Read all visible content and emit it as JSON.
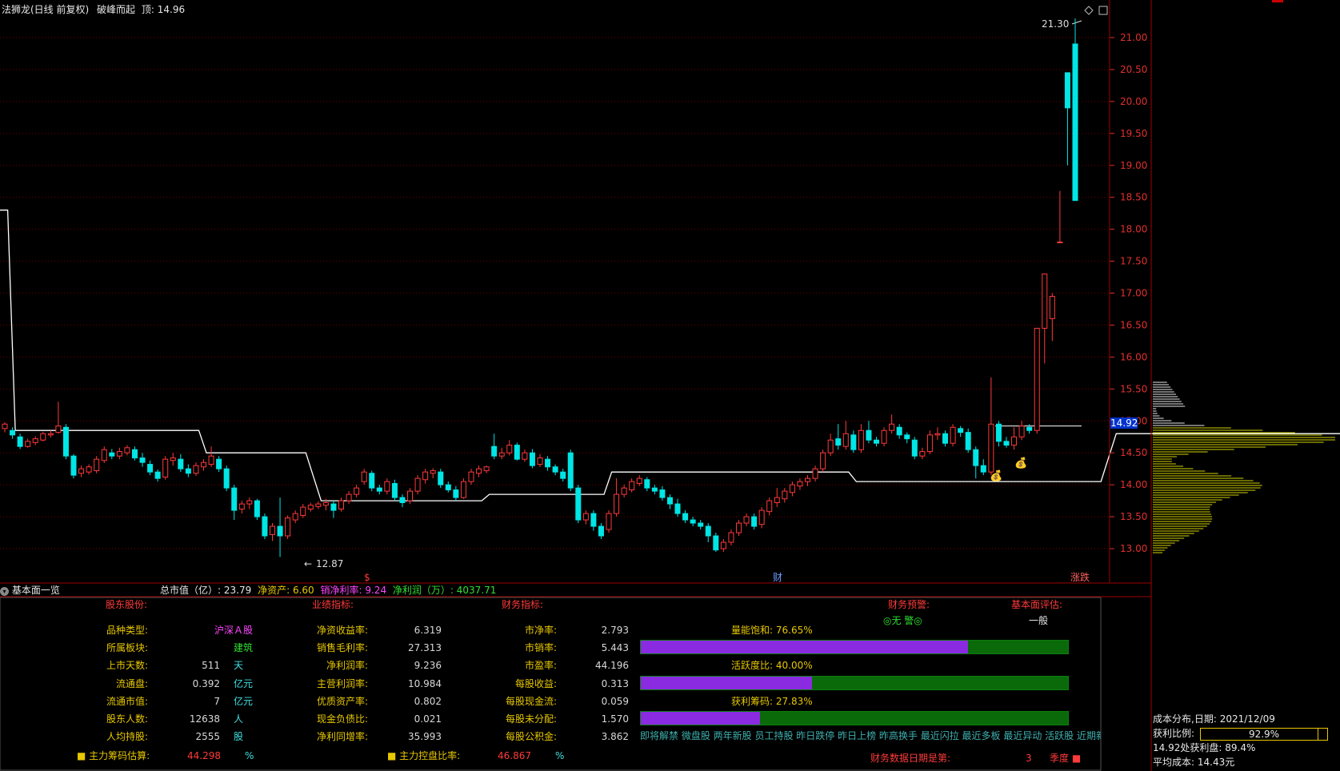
{
  "header": {
    "stock_name": "法狮龙(日线 前复权)",
    "indicator": "破峰而起",
    "top_label": "顶:",
    "top_value": "14.96"
  },
  "price_axis": {
    "ticks": [
      "21.00",
      "20.50",
      "20.00",
      "19.50",
      "19.00",
      "18.50",
      "18.00",
      "17.50",
      "17.00",
      "16.50",
      "16.00",
      "15.50",
      "15.00",
      "14.50",
      "14.00",
      "13.50",
      "13.00"
    ],
    "current_price": "14.92"
  },
  "annotations": {
    "high_label": "21.30",
    "low_label": "12.87",
    "marker_dollar": "$",
    "marker_finance": "财",
    "marker_limit": "涨跌"
  },
  "chart_data": {
    "type": "candlestick",
    "ylim": [
      12.7,
      21.6
    ],
    "candles": [
      [
        14.88,
        14.95,
        14.82,
        14.98
      ],
      [
        14.85,
        14.78,
        14.72,
        14.9
      ],
      [
        14.75,
        14.6,
        14.56,
        14.8
      ],
      [
        14.6,
        14.68,
        14.58,
        14.72
      ],
      [
        14.66,
        14.72,
        14.62,
        14.76
      ],
      [
        14.7,
        14.8,
        14.68,
        14.83
      ],
      [
        14.78,
        14.8,
        14.74,
        14.85
      ],
      [
        14.82,
        14.92,
        14.8,
        15.3
      ],
      [
        14.9,
        14.45,
        14.4,
        14.95
      ],
      [
        14.45,
        14.15,
        14.1,
        14.48
      ],
      [
        14.18,
        14.25,
        14.12,
        14.3
      ],
      [
        14.2,
        14.28,
        14.16,
        14.32
      ],
      [
        14.22,
        14.4,
        14.18,
        14.45
      ],
      [
        14.38,
        14.55,
        14.34,
        14.6
      ],
      [
        14.5,
        14.45,
        14.4,
        14.56
      ],
      [
        14.45,
        14.52,
        14.4,
        14.58
      ],
      [
        14.5,
        14.58,
        14.46,
        14.62
      ],
      [
        14.55,
        14.42,
        14.38,
        14.6
      ],
      [
        14.42,
        14.35,
        14.28,
        14.5
      ],
      [
        14.32,
        14.2,
        14.15,
        14.38
      ],
      [
        14.2,
        14.1,
        14.05,
        14.24
      ],
      [
        14.12,
        14.4,
        14.08,
        14.45
      ],
      [
        14.38,
        14.42,
        14.3,
        14.5
      ],
      [
        14.4,
        14.25,
        14.2,
        14.48
      ],
      [
        14.25,
        14.18,
        14.12,
        14.32
      ],
      [
        14.18,
        14.3,
        14.14,
        14.35
      ],
      [
        14.28,
        14.35,
        14.22,
        14.4
      ],
      [
        14.32,
        14.45,
        14.28,
        14.6
      ],
      [
        14.4,
        14.25,
        14.2,
        14.45
      ],
      [
        14.25,
        13.95,
        13.9,
        14.3
      ],
      [
        13.95,
        13.6,
        13.45,
        14.0
      ],
      [
        13.62,
        13.7,
        13.55,
        13.75
      ],
      [
        13.7,
        13.75,
        13.62,
        13.8
      ],
      [
        13.75,
        13.5,
        13.45,
        13.78
      ],
      [
        13.5,
        13.2,
        13.15,
        13.55
      ],
      [
        13.22,
        13.35,
        13.12,
        13.4
      ],
      [
        13.35,
        13.2,
        12.87,
        13.8
      ],
      [
        13.2,
        13.48,
        13.15,
        13.52
      ],
      [
        13.45,
        13.55,
        13.4,
        13.6
      ],
      [
        13.52,
        13.65,
        13.48,
        13.7
      ],
      [
        13.62,
        13.68,
        13.58,
        13.72
      ],
      [
        13.66,
        13.7,
        13.62,
        13.74
      ],
      [
        13.68,
        13.72,
        13.6,
        13.78
      ],
      [
        13.7,
        13.6,
        13.48,
        13.75
      ],
      [
        13.62,
        13.75,
        13.58,
        13.8
      ],
      [
        13.75,
        13.85,
        13.7,
        13.9
      ],
      [
        13.85,
        13.95,
        13.8,
        14.0
      ],
      [
        14.05,
        14.2,
        14.0,
        14.25
      ],
      [
        14.18,
        13.95,
        13.9,
        14.22
      ],
      [
        13.95,
        13.9,
        13.85,
        14.0
      ],
      [
        13.9,
        14.05,
        13.85,
        14.1
      ],
      [
        14.02,
        13.8,
        13.75,
        14.08
      ],
      [
        13.8,
        13.72,
        13.65,
        13.85
      ],
      [
        13.75,
        13.9,
        13.7,
        13.95
      ],
      [
        13.9,
        14.1,
        13.85,
        14.15
      ],
      [
        14.08,
        14.2,
        14.02,
        14.25
      ],
      [
        14.18,
        14.22,
        14.1,
        14.26
      ],
      [
        14.2,
        14.0,
        13.95,
        14.25
      ],
      [
        14.0,
        13.92,
        13.88,
        14.05
      ],
      [
        13.92,
        13.8,
        13.75,
        13.98
      ],
      [
        13.8,
        14.05,
        13.78,
        14.1
      ],
      [
        14.05,
        14.2,
        14.0,
        14.25
      ],
      [
        14.18,
        14.25,
        14.12,
        14.3
      ],
      [
        14.22,
        14.28,
        14.18,
        14.3
      ],
      [
        14.6,
        14.45,
        14.4,
        14.8
      ],
      [
        14.45,
        14.5,
        14.4,
        14.58
      ],
      [
        14.5,
        14.62,
        14.46,
        14.7
      ],
      [
        14.62,
        14.4,
        14.38,
        14.66
      ],
      [
        14.4,
        14.5,
        14.36,
        14.55
      ],
      [
        14.5,
        14.3,
        14.26,
        14.56
      ],
      [
        14.32,
        14.42,
        14.28,
        14.48
      ],
      [
        14.4,
        14.28,
        14.22,
        14.45
      ],
      [
        14.28,
        14.2,
        14.15,
        14.32
      ],
      [
        14.2,
        14.1,
        14.05,
        14.25
      ],
      [
        14.5,
        13.95,
        13.9,
        14.55
      ],
      [
        13.95,
        13.45,
        13.4,
        14.0
      ],
      [
        13.45,
        13.55,
        13.38,
        13.6
      ],
      [
        13.55,
        13.35,
        13.28,
        13.6
      ],
      [
        13.35,
        13.2,
        13.15,
        13.4
      ],
      [
        13.3,
        13.55,
        13.25,
        13.6
      ],
      [
        13.55,
        13.85,
        13.5,
        14.1
      ],
      [
        13.85,
        13.95,
        13.8,
        14.0
      ],
      [
        13.92,
        14.05,
        13.88,
        14.1
      ],
      [
        14.02,
        14.1,
        13.98,
        14.15
      ],
      [
        14.08,
        13.95,
        13.9,
        14.12
      ],
      [
        13.95,
        13.9,
        13.85,
        14.0
      ],
      [
        13.92,
        13.8,
        13.75,
        13.98
      ],
      [
        13.8,
        13.7,
        13.62,
        13.85
      ],
      [
        13.7,
        13.55,
        13.5,
        13.78
      ],
      [
        13.55,
        13.45,
        13.4,
        13.6
      ],
      [
        13.45,
        13.4,
        13.35,
        13.5
      ],
      [
        13.4,
        13.35,
        13.3,
        13.45
      ],
      [
        13.35,
        13.2,
        13.1,
        13.4
      ],
      [
        13.2,
        12.98,
        12.95,
        13.25
      ],
      [
        13.0,
        13.1,
        12.95,
        13.15
      ],
      [
        13.1,
        13.25,
        13.05,
        13.3
      ],
      [
        13.25,
        13.4,
        13.2,
        13.45
      ],
      [
        13.4,
        13.5,
        13.35,
        13.55
      ],
      [
        13.5,
        13.35,
        13.3,
        13.55
      ],
      [
        13.38,
        13.6,
        13.32,
        13.65
      ],
      [
        13.58,
        13.75,
        13.52,
        13.8
      ],
      [
        13.72,
        13.8,
        13.65,
        13.95
      ],
      [
        13.78,
        13.9,
        13.72,
        13.95
      ],
      [
        13.88,
        14.0,
        13.82,
        14.05
      ],
      [
        13.98,
        14.05,
        13.92,
        14.1
      ],
      [
        14.05,
        14.1,
        13.98,
        14.15
      ],
      [
        14.1,
        14.25,
        14.05,
        14.3
      ],
      [
        14.25,
        14.5,
        14.2,
        14.55
      ],
      [
        14.5,
        14.7,
        14.45,
        14.8
      ],
      [
        14.72,
        14.62,
        14.55,
        14.95
      ],
      [
        14.6,
        14.8,
        14.55,
        15.0
      ],
      [
        14.78,
        14.55,
        14.5,
        14.85
      ],
      [
        14.55,
        14.85,
        14.5,
        14.95
      ],
      [
        14.85,
        14.7,
        14.65,
        15.0
      ],
      [
        14.7,
        14.65,
        14.6,
        14.75
      ],
      [
        14.65,
        14.85,
        14.6,
        14.9
      ],
      [
        14.85,
        14.95,
        14.8,
        15.1
      ],
      [
        14.9,
        14.78,
        14.72,
        14.95
      ],
      [
        14.78,
        14.72,
        14.65,
        14.82
      ],
      [
        14.7,
        14.45,
        14.4,
        14.75
      ],
      [
        14.45,
        14.52,
        14.4,
        14.58
      ],
      [
        14.52,
        14.78,
        14.48,
        14.85
      ],
      [
        14.78,
        14.8,
        14.7,
        14.9
      ],
      [
        14.8,
        14.65,
        14.6,
        14.85
      ],
      [
        14.65,
        14.9,
        14.6,
        14.95
      ],
      [
        14.88,
        14.82,
        14.75,
        14.92
      ],
      [
        14.82,
        14.55,
        14.5,
        14.88
      ],
      [
        14.55,
        14.3,
        14.1,
        14.6
      ],
      [
        14.3,
        14.2,
        14.15,
        14.4
      ],
      [
        14.2,
        14.95,
        14.15,
        15.68
      ],
      [
        14.95,
        14.68,
        14.6,
        15.0
      ],
      [
        14.68,
        14.62,
        14.58,
        14.75
      ],
      [
        14.62,
        14.75,
        14.55,
        14.9
      ],
      [
        14.75,
        14.92,
        14.7,
        15.0
      ],
      [
        14.9,
        14.85,
        14.8,
        14.95
      ],
      [
        14.85,
        16.45,
        14.8,
        16.45
      ],
      [
        16.45,
        17.3,
        15.9,
        17.3
      ],
      [
        16.6,
        16.95,
        16.25,
        17.0
      ],
      [
        17.8,
        17.8,
        17.8,
        18.6
      ],
      [
        20.45,
        19.9,
        19.0,
        20.45
      ],
      [
        20.9,
        18.45,
        18.45,
        21.3
      ]
    ],
    "support_line": [
      [
        0,
        18.3
      ],
      [
        1,
        18.3
      ],
      [
        2,
        14.85
      ],
      [
        26,
        14.85
      ],
      [
        27,
        14.5
      ],
      [
        40,
        14.5
      ],
      [
        42,
        13.75
      ],
      [
        63,
        13.75
      ],
      [
        64,
        13.85
      ],
      [
        79,
        13.85
      ],
      [
        80,
        14.2
      ],
      [
        111,
        14.2
      ],
      [
        112,
        14.05
      ],
      [
        144,
        14.05
      ],
      [
        146,
        14.8
      ],
      [
        203,
        14.8
      ],
      [
        210,
        14.92
      ],
      [
        217,
        14.95
      ]
    ],
    "cost_distribution": {
      "title": "成本分布,日期:",
      "date": "2021/12/09",
      "profit_ratio_label": "获利比例:",
      "profit_ratio_value": "92.9%",
      "profit_ratio_fraction": 0.929,
      "at_price_label": "14.92处获利盘:",
      "at_price_value": "89.4%",
      "avg_cost_label": "平均成本:",
      "avg_cost_value": "14.43元"
    }
  },
  "ticker_bar": {
    "panel_title": "基本面一览",
    "market_cap_label": "总市值（亿）:",
    "market_cap_value": "23.79",
    "net_assets_label": "净资产:",
    "net_assets_value": "6.60",
    "net_margin_label": "销净利率:",
    "net_margin_value": "9.24",
    "net_profit_label": "净利润（万）:",
    "net_profit_value": "4037.71"
  },
  "fundamentals": {
    "sections": {
      "shareholders": "股东股份:",
      "performance": "业绩指标:",
      "finance": "财务指标:",
      "warning": "财务预警:",
      "evaluation": "基本面评估:"
    },
    "col1": [
      {
        "label": "品种类型:",
        "value": "沪深Ａ股",
        "unit": ""
      },
      {
        "label": "所属板块:",
        "value": "建筑",
        "unit": ""
      },
      {
        "label": "上市天数:",
        "value": "511",
        "unit": "天"
      },
      {
        "label": "流通盘:",
        "value": "0.392",
        "unit": "亿元"
      },
      {
        "label": "流通市值:",
        "value": "7",
        "unit": "亿元"
      },
      {
        "label": "股东人数:",
        "value": "12638",
        "unit": "人"
      },
      {
        "label": "人均持股:",
        "value": "2555",
        "unit": "股"
      }
    ],
    "col2": [
      {
        "label": "净资收益率:",
        "value": "6.319"
      },
      {
        "label": "销售毛利率:",
        "value": "27.313"
      },
      {
        "label": "净利润率:",
        "value": "9.236"
      },
      {
        "label": "主营利润率:",
        "value": "10.984"
      },
      {
        "label": "优质资产率:",
        "value": "0.802"
      },
      {
        "label": "现金负债比:",
        "value": "0.021"
      },
      {
        "label": "净利同增率:",
        "value": "35.993"
      }
    ],
    "col3": [
      {
        "label": "市净率:",
        "value": "2.793"
      },
      {
        "label": "市销率:",
        "value": "5.443"
      },
      {
        "label": "市盈率:",
        "value": "44.196"
      },
      {
        "label": "每股收益:",
        "value": "0.313"
      },
      {
        "label": "每股现金流:",
        "value": "0.059"
      },
      {
        "label": "每股未分配:",
        "value": "1.570"
      },
      {
        "label": "每股公积金:",
        "value": "3.862"
      }
    ],
    "bars": [
      {
        "label": "量能饱和:",
        "value": "76.65%",
        "fraction": 0.7665
      },
      {
        "label": "活跃度比:",
        "value": "40.00%",
        "fraction": 0.4
      },
      {
        "label": "获利筹码:",
        "value": "27.83%",
        "fraction": 0.2783
      }
    ],
    "warning_value": "◎无 警◎",
    "evaluation_value": "一般",
    "bottom": {
      "main_chip_label": "主力筹码估算:",
      "main_chip_value": "44.298",
      "main_chip_unit": "%",
      "control_label": "主力控盘比率:",
      "control_value": "46.867",
      "control_unit": "%",
      "report_label": "财务数据日期是第:",
      "report_value": "3",
      "report_unit": "季度"
    },
    "tags": "即将解禁 微盘股 两年新股 员工持股 昨日跌停 昨日上榜 昨高换手 最近闪拉 最近多板 最近异动 活跃股 近期新高"
  },
  "colors": {
    "up": "#ff3a3a",
    "down": "#00e5e5",
    "grid": "#7a0000",
    "axis_text": "#e03030",
    "support": "#ffffff",
    "cost_bars": "#d4d400"
  }
}
